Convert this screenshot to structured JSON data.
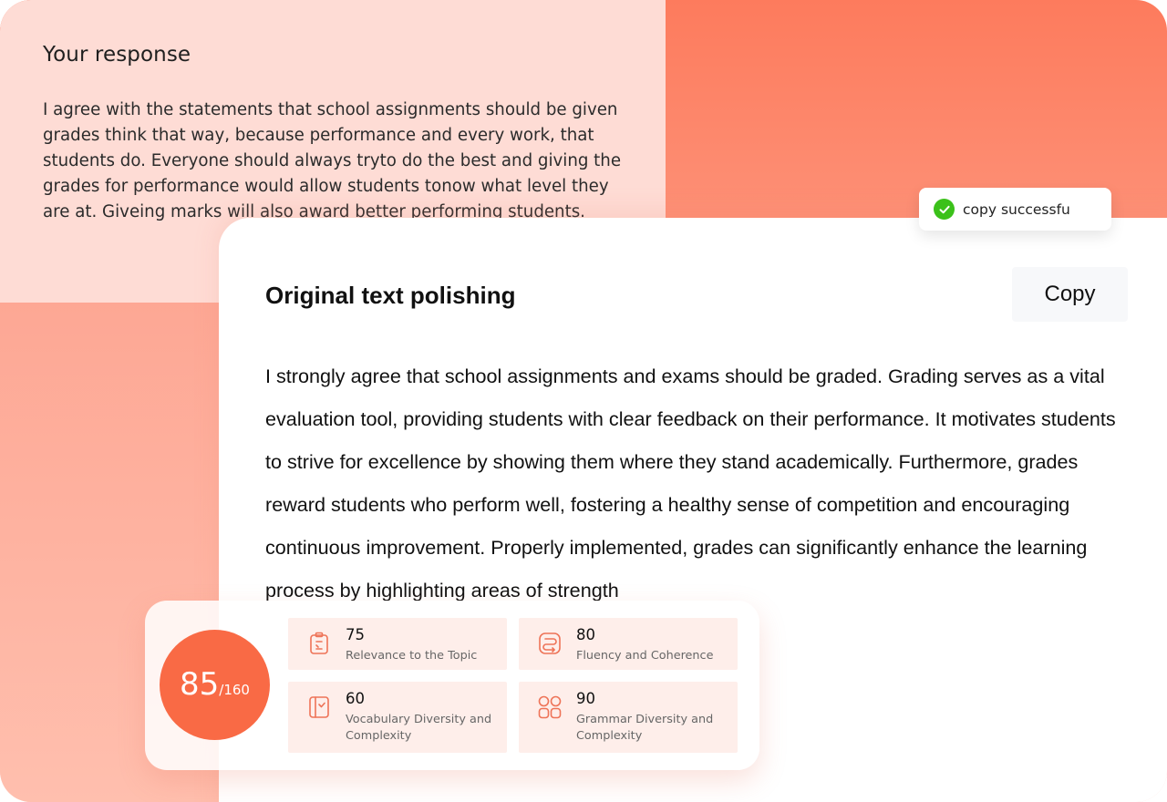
{
  "response": {
    "title": "Your response",
    "text": "I agree with the statements that school assignments should be given grades think that way, because performance and every work, that students do. Everyone should always tryto do the best and giving the grades for performance would allow students tonow what level they are at. Giveing marks will also award better performing students."
  },
  "polishing": {
    "title": "Original text polishing",
    "copy_label": "Copy",
    "text": "I strongly agree that school assignments and exams should be graded.  Grading serves as a vital evaluation tool, providing students with clear feedback on their performance.  It motivates students to strive for excellence by showing them where they stand academically.  Furthermore, grades reward students who perform well, fostering a healthy sense of competition and encouraging continuous improvement.  Properly implemented, grades can significantly enhance the learning process by highlighting areas of strength"
  },
  "toast": {
    "text": "copy successfu",
    "icon": "check-circle-icon",
    "color": "#3bc11a"
  },
  "score": {
    "value": "85",
    "max": "/160",
    "color": "#f96a45",
    "metrics": [
      {
        "value": "75",
        "label": "Relevance to the Topic",
        "icon": "clipboard-icon"
      },
      {
        "value": "80",
        "label": "Fluency and Coherence",
        "icon": "flow-icon"
      },
      {
        "value": "60",
        "label": "Vocabulary Diversity and Complexity",
        "icon": "notebook-icon"
      },
      {
        "value": "90",
        "label": "Grammar Diversity and Complexity",
        "icon": "grid-icon"
      }
    ]
  }
}
